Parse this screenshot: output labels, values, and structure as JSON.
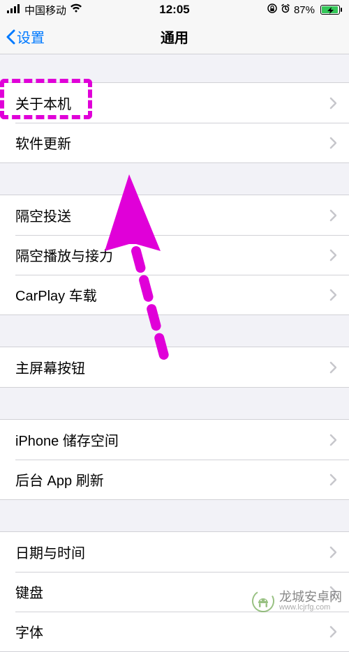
{
  "status": {
    "carrier": "中国移动",
    "time": "12:05",
    "battery_pct": "87%",
    "battery_fill_pct": 87
  },
  "nav": {
    "back_label": "设置",
    "title": "通用"
  },
  "groups": [
    {
      "rows": [
        {
          "label": "关于本机"
        },
        {
          "label": "软件更新"
        }
      ]
    },
    {
      "rows": [
        {
          "label": "隔空投送"
        },
        {
          "label": "隔空播放与接力"
        },
        {
          "label": "CarPlay 车载"
        }
      ]
    },
    {
      "rows": [
        {
          "label": "主屏幕按钮"
        }
      ]
    },
    {
      "rows": [
        {
          "label": "iPhone 储存空间"
        },
        {
          "label": "后台 App 刷新"
        }
      ]
    },
    {
      "rows": [
        {
          "label": "日期与时间"
        },
        {
          "label": "键盘"
        },
        {
          "label": "字体"
        }
      ]
    }
  ],
  "watermark": {
    "name": "龙城安卓网",
    "url": "www.lcjrfg.com"
  },
  "annotation": {
    "arrow_color": "#e000d8"
  }
}
